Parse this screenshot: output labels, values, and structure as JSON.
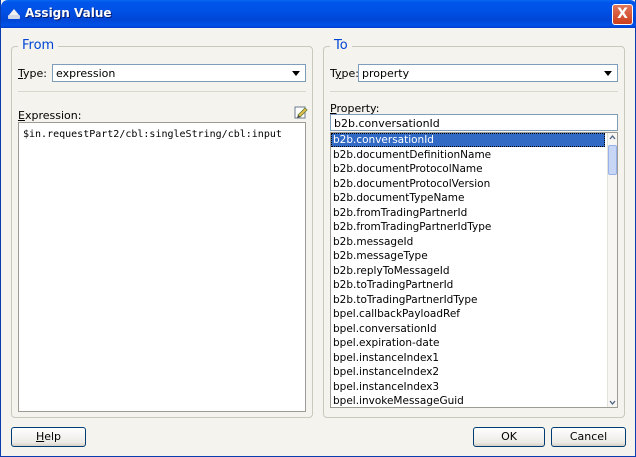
{
  "window": {
    "title": "Assign Value",
    "close_glyph": "X"
  },
  "from": {
    "legend": "From",
    "type_label_u": "T",
    "type_label_rest": "ype:",
    "type_value": "expression",
    "expr_label_u": "E",
    "expr_label_rest": "xpression:",
    "expression": "$in.requestPart2/cbl:singleString/cbl:input"
  },
  "to": {
    "legend": "To",
    "type_label_pre": "T",
    "type_label_u": "y",
    "type_label_rest": "pe:",
    "type_value": "property",
    "prop_label_u": "P",
    "prop_label_rest": "roperty:",
    "property_value": "b2b.conversationId",
    "properties": [
      "b2b.conversationId",
      "b2b.documentDefinitionName",
      "b2b.documentProtocolName",
      "b2b.documentProtocolVersion",
      "b2b.documentTypeName",
      "b2b.fromTradingPartnerId",
      "b2b.fromTradingPartnerIdType",
      "b2b.messageId",
      "b2b.messageType",
      "b2b.replyToMessageId",
      "b2b.toTradingPartnerId",
      "b2b.toTradingPartnerIdType",
      "bpel.callbackPayloadRef",
      "bpel.conversationId",
      "bpel.expiration-date",
      "bpel.instanceIndex1",
      "bpel.instanceIndex2",
      "bpel.instanceIndex3",
      "bpel.invokeMessageGuid"
    ],
    "selected_index": 0
  },
  "buttons": {
    "help_u": "H",
    "help_rest": "elp",
    "ok": "OK",
    "cancel": "Cancel"
  },
  "colors": {
    "title_bar": "#0051e6",
    "legend": "#0046d5",
    "selection": "#316ac5"
  }
}
